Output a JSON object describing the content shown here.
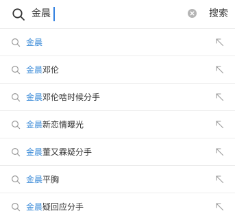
{
  "search": {
    "value": "金晨",
    "submit_label": "搜索"
  },
  "icons": {
    "search": "search-icon",
    "clear": "clear-icon",
    "fill": "arrow-up-left-icon"
  },
  "colors": {
    "highlight": "#3b8bd8",
    "caret": "#2f7fe0",
    "text": "#333333",
    "icon": "#9a9a9a",
    "divider": "#ececec"
  },
  "suggestions": [
    {
      "highlight": "金晨",
      "rest": ""
    },
    {
      "highlight": "金晨",
      "rest": "邓伦"
    },
    {
      "highlight": "金晨",
      "rest": "邓伦啥时候分手"
    },
    {
      "highlight": "金晨",
      "rest": "新恋情曝光"
    },
    {
      "highlight": "金晨",
      "rest": "董又霖疑分手"
    },
    {
      "highlight": "金晨",
      "rest": "平胸"
    },
    {
      "highlight": "金晨",
      "rest": "疑回应分手"
    }
  ]
}
